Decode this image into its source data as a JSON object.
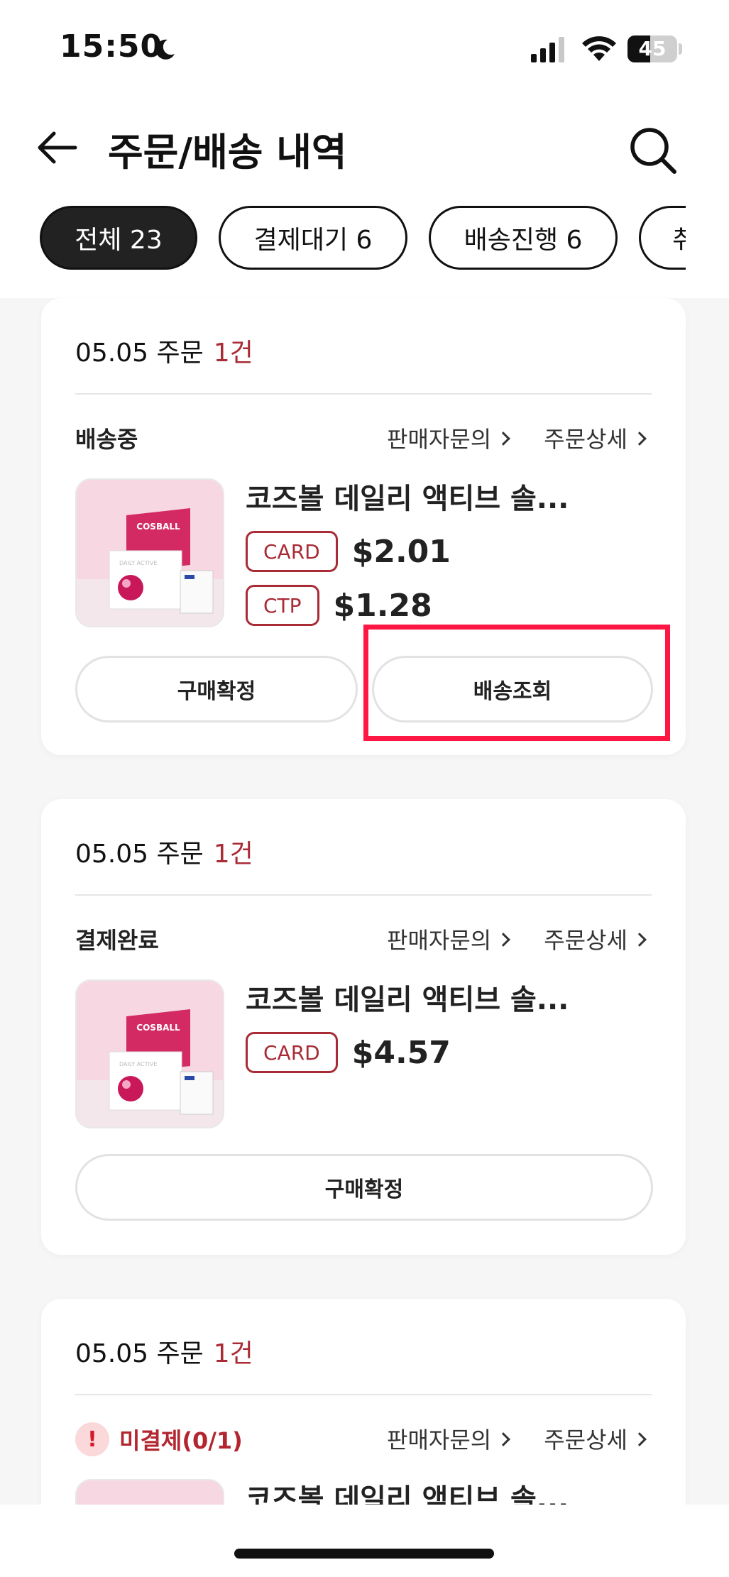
{
  "status_bar": {
    "time": "15:50",
    "battery": "45",
    "battery_level": 0.45
  },
  "header": {
    "title": "주문/배송 내역"
  },
  "chips": [
    {
      "label": "전체 23",
      "active": true
    },
    {
      "label": "결제대기 6",
      "active": false
    },
    {
      "label": "배송진행 6",
      "active": false
    },
    {
      "label": "취",
      "active": false
    }
  ],
  "links": {
    "seller_inquiry": "판매자문의",
    "order_detail": "주문상세"
  },
  "orders": [
    {
      "date": "05.05 주문",
      "count": "1건",
      "status": "배송중",
      "product_name": "코즈볼 데일리 액티브 솔...",
      "prices": [
        {
          "method": "CARD",
          "amount": "$2.01"
        },
        {
          "method": "CTP",
          "amount": "$1.28"
        }
      ],
      "buttons": {
        "confirm": "구매확정",
        "track": "배송조회"
      }
    },
    {
      "date": "05.05 주문",
      "count": "1건",
      "status": "결제완료",
      "product_name": "코즈볼 데일리 액티브 솔...",
      "prices": [
        {
          "method": "CARD",
          "amount": "$4.57"
        }
      ],
      "buttons": {
        "confirm": "구매확정"
      }
    },
    {
      "date": "05.05 주문",
      "count": "1건",
      "status": "미결제(0/1)",
      "product_name": "코즈볼 데일리 액티브 솔..."
    }
  ],
  "product_image": {
    "brand": "COSBALL",
    "box_label": "DAILY ACTIVE"
  },
  "colors": {
    "accent": "#a82b35",
    "highlight": "#ff1744"
  }
}
